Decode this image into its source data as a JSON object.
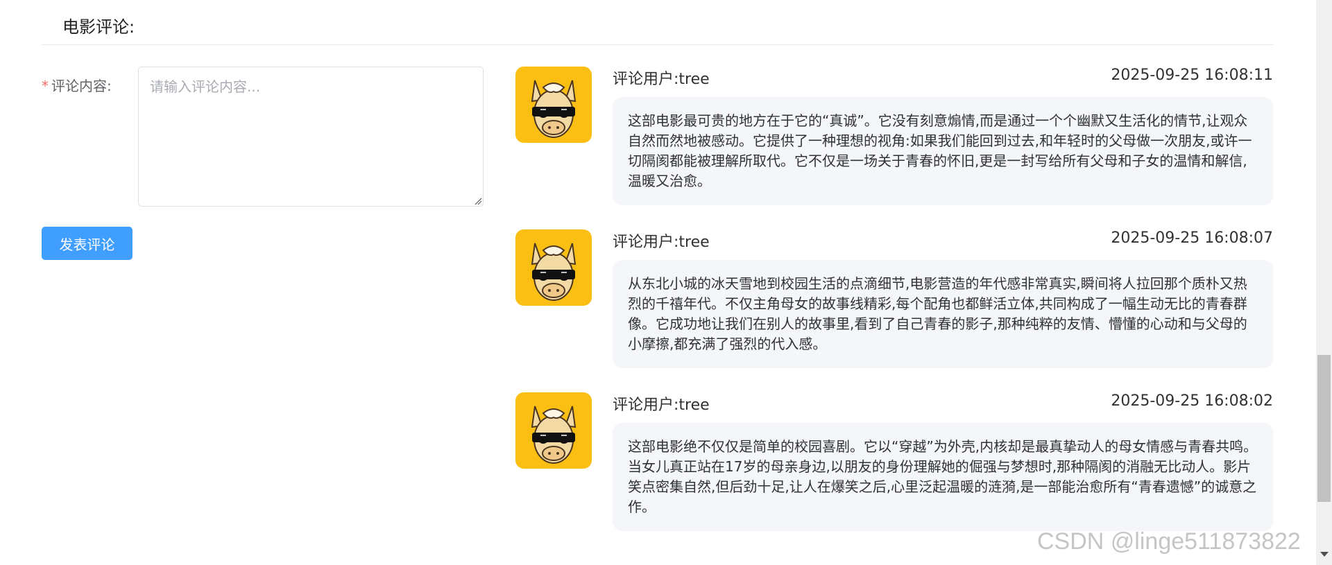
{
  "section": {
    "title": "电影评论:"
  },
  "form": {
    "required_mark": "*",
    "label": "评论内容:",
    "placeholder": "请输入评论内容...",
    "value": "",
    "submit_label": "发表评论"
  },
  "comments": [
    {
      "user": "评论用户:tree",
      "time": "2025-09-25 16:08:11",
      "content": "这部电影最可贵的地方在于它的“真诚”。它没有刻意煽情,而是通过一个个幽默又生活化的情节,让观众自然而然地被感动。它提供了一种理想的视角:如果我们能回到过去,和年轻时的父母做一次朋友,或许一切隔阂都能被理解所取代。它不仅是一场关于青春的怀旧,更是一封写给所有父母和子女的温情和解信,温暖又治愈。"
    },
    {
      "user": "评论用户:tree",
      "time": "2025-09-25 16:08:07",
      "content": "从东北小城的冰天雪地到校园生活的点滴细节,电影营造的年代感非常真实,瞬间将人拉回那个质朴又热烈的千禧年代。不仅主角母女的故事线精彩,每个配角也都鲜活立体,共同构成了一幅生动无比的青春群像。它成功地让我们在别人的故事里,看到了自己青春的影子,那种纯粹的友情、懵懂的心动和与父母的小摩擦,都充满了强烈的代入感。"
    },
    {
      "user": "评论用户:tree",
      "time": "2025-09-25 16:08:02",
      "content": "这部电影绝不仅仅是简单的校园喜剧。它以“穿越”为外壳,内核却是最真挚动人的母女情感与青春共鸣。当女儿真正站在17岁的母亲身边,以朋友的身份理解她的倔强与梦想时,那种隔阂的消融无比动人。影片笑点密集自然,但后劲十足,让人在爆笑之后,心里泛起温暖的涟漪,是一部能治愈所有“青春遗憾”的诚意之作。"
    }
  ],
  "watermark": "CSDN @linge511873822",
  "colors": {
    "primary": "#409eff",
    "required": "#f56c6c",
    "avatar_bg": "#fbbf14",
    "bubble_bg": "#f4f6f9"
  },
  "icons": {
    "avatar": "cartoon-horse-sunglasses-avatar",
    "resize": "textarea-resize-grip-icon",
    "scroll_down": "scroll-down-arrow-icon"
  }
}
